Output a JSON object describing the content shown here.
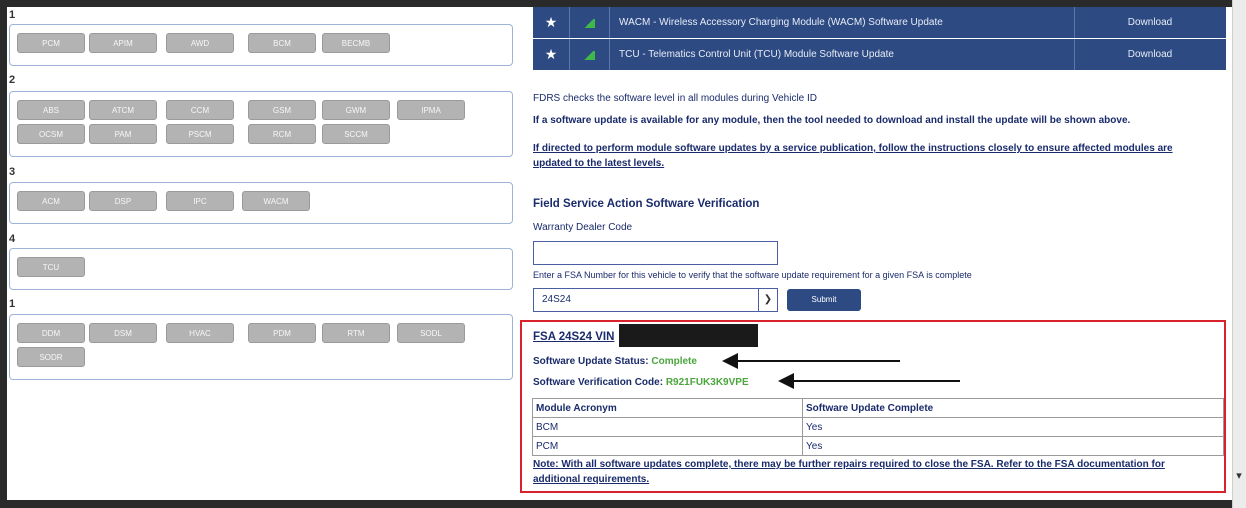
{
  "left_panel": {
    "groups": [
      {
        "number": "1",
        "modules": [
          "PCM",
          "APIM",
          "AWD",
          "BCM",
          "BECMB"
        ]
      },
      {
        "number": "2",
        "modules": [
          "ABS",
          "ATCM",
          "CCM",
          "GSM",
          "GWM",
          "IPMA",
          "OCSM",
          "PAM",
          "PSCM",
          "RCM",
          "SCCM"
        ]
      },
      {
        "number": "3",
        "modules": [
          "ACM",
          "DSP",
          "IPC",
          "WACM"
        ]
      },
      {
        "number": "4",
        "modules": [
          "TCU"
        ]
      },
      {
        "number": "1",
        "modules": [
          "DDM",
          "DSM",
          "HVAC",
          "PDM",
          "RTM",
          "SODL",
          "SODR"
        ]
      }
    ]
  },
  "downloads": [
    {
      "title": "WACM - Wireless Accessory Charging Module (WACM) Software Update",
      "action": "Download"
    },
    {
      "title": "TCU - Telematics Control Unit (TCU) Module Software Update",
      "action": "Download"
    }
  ],
  "info": {
    "line1": "FDRS checks the software level in all modules during Vehicle ID",
    "line2": "If a software update is available for any module, then the tool needed to download and install the update will be shown above.",
    "line3a": "If directed to perform module software updates by a service publication, follow the instructions closely to ensure affected modules are",
    "line3b": "updated to the latest levels."
  },
  "fsa": {
    "section_title": "Field Service Action Software Verification",
    "dealer_label": "Warranty Dealer Code",
    "dealer_value": "",
    "instruction": "Enter a FSA Number for this vehicle to verify that the software update requirement for a given FSA is complete",
    "selected_fsa": "24S24",
    "submit_label": "Submit"
  },
  "result": {
    "heading": "FSA 24S24 VIN",
    "status_label": "Software Update Status:",
    "status_value": "Complete",
    "code_label": "Software Verification Code:",
    "code_value": "R921FUK3K9VPE",
    "table": {
      "headers": [
        "Module Acronym",
        "Software Update Complete"
      ],
      "rows": [
        [
          "BCM",
          "Yes"
        ],
        [
          "PCM",
          "Yes"
        ]
      ]
    },
    "note_a": "Note: With all software updates complete, there may be further repairs required to close the FSA. Refer to the FSA documentation for",
    "note_b": "additional requirements."
  },
  "colors": {
    "accent": "#2d4a82",
    "status_ok": "#4aa63c",
    "highlight_border": "#d9232c"
  }
}
